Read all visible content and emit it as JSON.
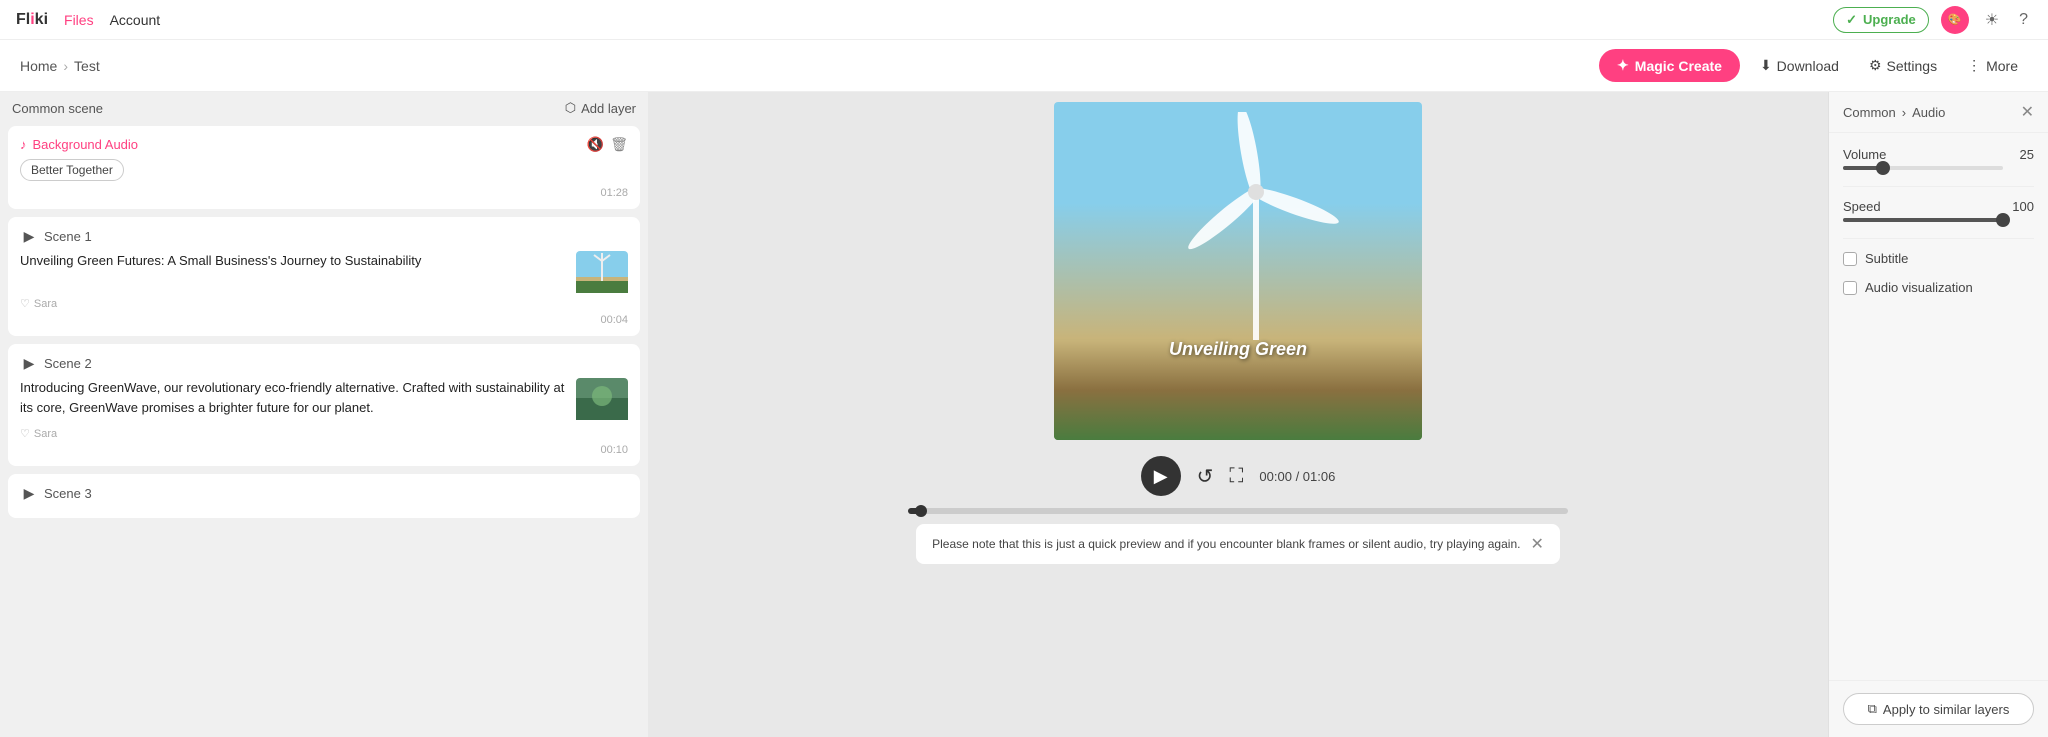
{
  "app": {
    "logo_text": "Fliki",
    "nav_files": "Files",
    "nav_account": "Account",
    "upgrade_label": "Upgrade",
    "check_icon": "✓"
  },
  "breadcrumb": {
    "home": "Home",
    "sep": "›",
    "project": "Test"
  },
  "toolbar": {
    "magic_create": "✦ Magic Create",
    "download": "Download",
    "settings": "Settings",
    "more": "More"
  },
  "left_panel": {
    "common_scene_title": "Common scene",
    "add_layer_label": "⬡ Add layer",
    "background_audio_label": "Background Audio",
    "audio_tag": "Better Together",
    "audio_duration": "01:28",
    "scenes": [
      {
        "id": "scene-1",
        "title": "Scene 1",
        "text": "Unveiling Green Futures: A Small Business's Journey to Sustainability",
        "author": "Sara",
        "duration": "00:04",
        "has_thumb": true
      },
      {
        "id": "scene-2",
        "title": "Scene 2",
        "text": "Introducing GreenWave, our revolutionary eco-friendly alternative. Crafted with sustainability at its core, GreenWave promises a brighter future for our planet.",
        "author": "Sara",
        "duration": "00:10",
        "has_thumb": true
      },
      {
        "id": "scene-3",
        "title": "Scene 3",
        "text": "",
        "author": "",
        "duration": "",
        "has_thumb": false
      }
    ]
  },
  "video_preview": {
    "overlay_text": "Unveiling Green",
    "current_time": "00:00",
    "total_time": "01:06",
    "time_display": "00:00 / 01:06"
  },
  "notice": {
    "text": "Please note that this is just a quick preview and if you encounter blank frames or silent audio, try playing again."
  },
  "right_panel": {
    "breadcrumb_common": "Common",
    "breadcrumb_sep": "›",
    "breadcrumb_audio": "Audio",
    "volume_label": "Volume",
    "volume_value": "25",
    "volume_pct": 25,
    "speed_label": "Speed",
    "speed_value": "100",
    "speed_pct": 100,
    "subtitle_label": "Subtitle",
    "audio_viz_label": "Audio visualization",
    "apply_label": "Apply to similar layers"
  }
}
